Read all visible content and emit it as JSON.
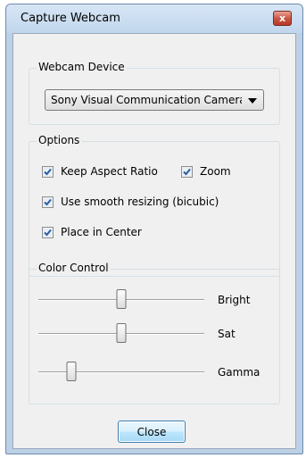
{
  "window": {
    "title": "Capture Webcam",
    "close_glyph": "x"
  },
  "device_group": {
    "legend": "Webcam Device",
    "selected": "Sony Visual Communication Camera"
  },
  "options_group": {
    "legend": "Options",
    "keep_aspect": {
      "label": "Keep Aspect Ratio",
      "checked": true
    },
    "zoom": {
      "label": "Zoom",
      "checked": true
    },
    "smooth": {
      "label": "Use smooth resizing (bicubic)",
      "checked": true
    },
    "center": {
      "label": "Place in Center",
      "checked": true
    }
  },
  "color_group": {
    "legend": "Color Control",
    "bright": {
      "label": "Bright",
      "level": 0.5
    },
    "sat": {
      "label": "Sat",
      "level": 0.5
    },
    "gamma": {
      "label": "Gamma",
      "level": 0.2
    }
  },
  "close_button": {
    "label": "Close"
  },
  "colors": {
    "frame": "#bcd0e6",
    "client": "#f0f0f0",
    "close_x": "#c65340",
    "check_mark": "#2a5d9f"
  }
}
